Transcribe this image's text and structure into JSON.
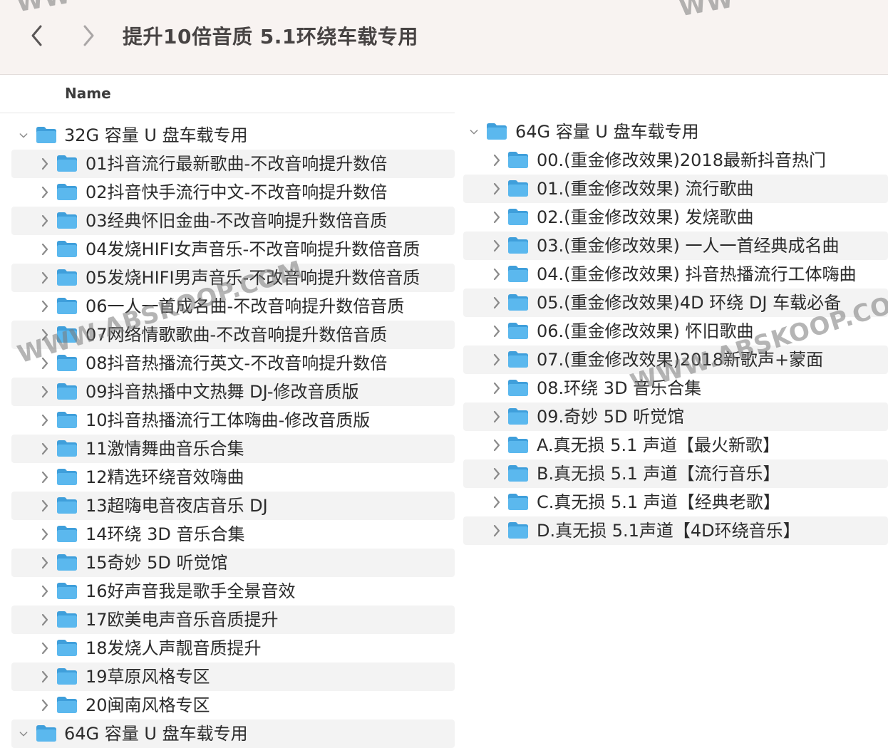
{
  "window": {
    "title": "提升10倍音质 5.1环绕车载专用",
    "back_icon": "chevron-left-icon",
    "forward_icon": "chevron-right-icon"
  },
  "column_header": {
    "name_label": "Name"
  },
  "left_tree": {
    "parent": {
      "label": "32G 容量 U 盘车载专用",
      "expanded": true
    },
    "items": [
      "01抖音流行最新歌曲-不改音响提升数倍",
      "02抖音快手流行中文-不改音响提升数倍",
      "03经典怀旧金曲-不改音响提升数倍音质",
      "04发烧HIFI女声音乐-不改音响提升数倍音质",
      "05发烧HIFI男声音乐-不改音响提升数倍音质",
      "06一人一首成名曲-不改音响提升数倍音质",
      "07网络情歌歌曲-不改音响提升数倍音质",
      "08抖音热播流行英文-不改音响提升数倍",
      "09抖音热播中文热舞 DJ-修改音质版",
      "10抖音热播流行工体嗨曲-修改音质版",
      "11激情舞曲音乐合集",
      "12精选环绕音效嗨曲",
      "13超嗨电音夜店音乐 DJ",
      "14环绕 3D 音乐合集",
      "15奇妙 5D 听觉馆",
      "16好声音我是歌手全景音效",
      "17欧美电声音乐音质提升",
      "18发烧人声靓音质提升",
      "19草原风格专区",
      "20闽南风格专区"
    ],
    "next_parent": {
      "label": "64G 容量 U 盘车载专用",
      "expanded": true
    }
  },
  "right_tree": {
    "parent": {
      "label": "64G 容量 U 盘车载专用",
      "expanded": true
    },
    "items": [
      "00.(重金修改效果)2018最新抖音热门",
      "01.(重金修改效果) 流行歌曲",
      "02.(重金修改效果) 发烧歌曲",
      "03.(重金修改效果) 一人一首经典成名曲",
      "04.(重金修改效果) 抖音热播流行工体嗨曲",
      "05.(重金修改效果)4D 环绕 DJ 车载必备",
      "06.(重金修改效果) 怀旧歌曲",
      "07.(重金修改效果)2018新歌声+蒙面",
      "08.环绕 3D 音乐合集",
      "09.奇妙 5D 听觉馆",
      "A.真无损 5.1 声道【最火新歌】",
      "B.真无损 5.1 声道【流行音乐】",
      "C.真无损 5.1 声道【经典老歌】",
      "D.真无损 5.1声道【4D环绕音乐】"
    ]
  },
  "watermarks": [
    "WWW.ABSKOOP.COM",
    "WWW.ABSKOOP.COM",
    "WW",
    "WW"
  ],
  "colors": {
    "folder_blue": "#5bb8ee",
    "folder_tab": "#3f9fdb",
    "titlebar_bg": "#f8f3f1",
    "stripe_bg": "#f3f3f3"
  }
}
